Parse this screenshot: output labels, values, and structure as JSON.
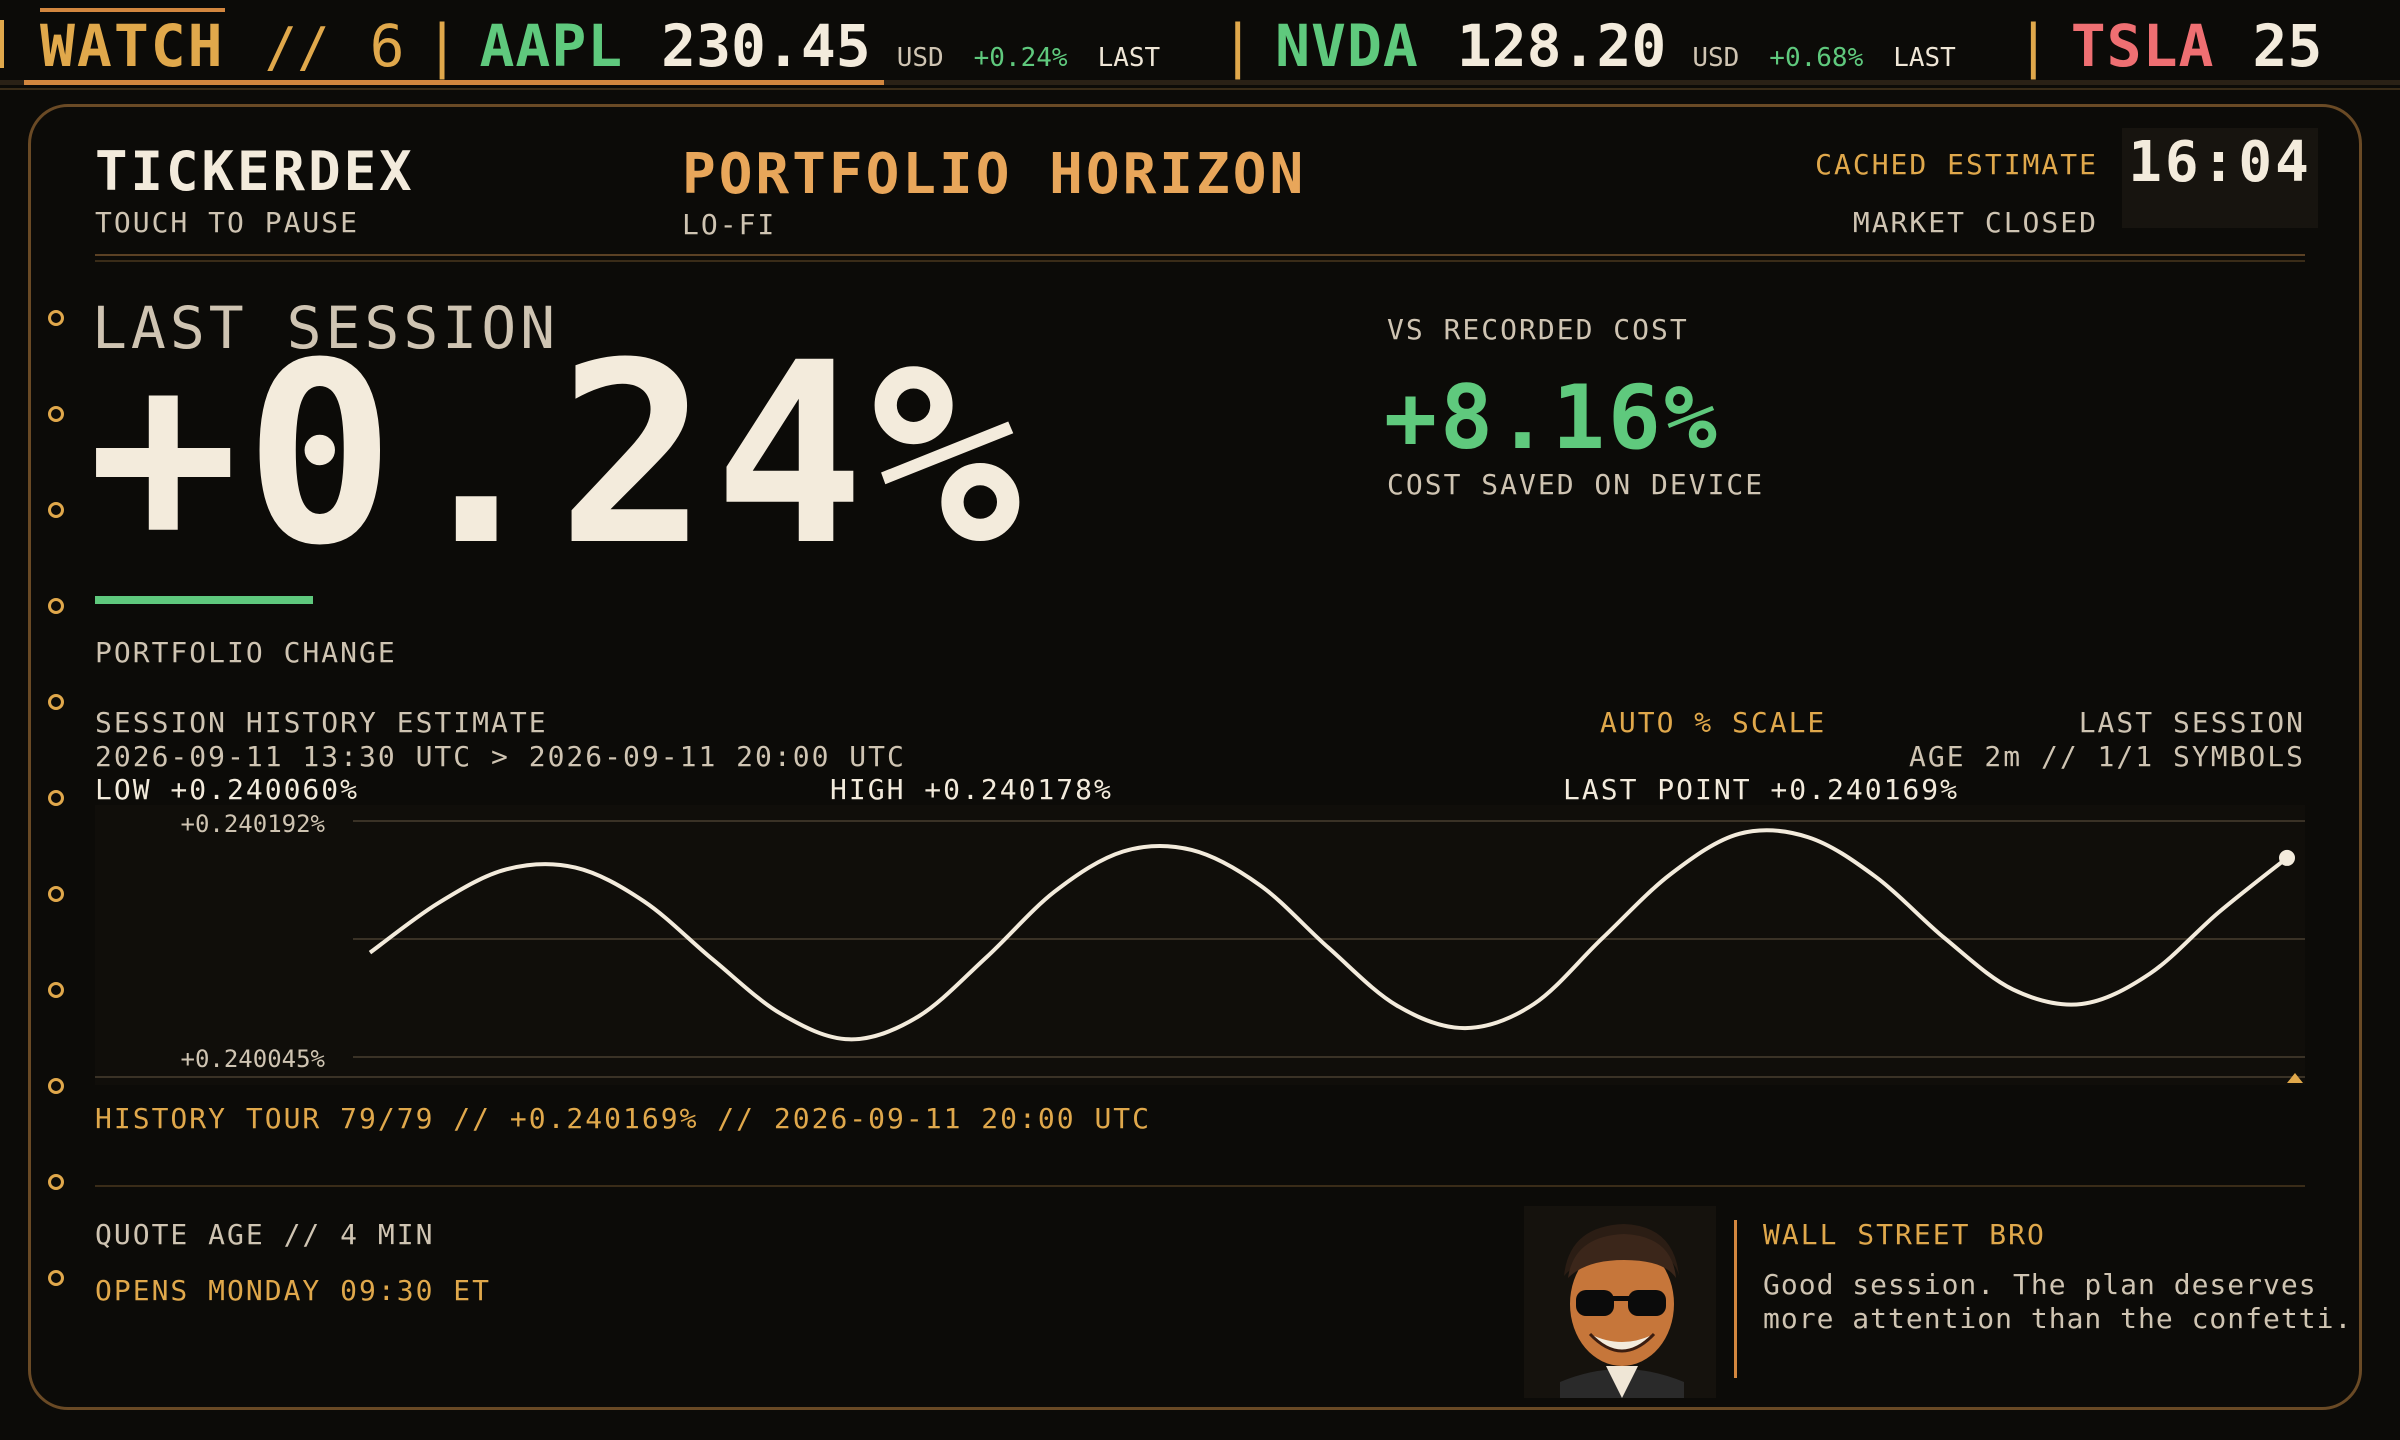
{
  "ticker": {
    "watch_label": "WATCH",
    "separator": "//",
    "watch_count": "6",
    "items": [
      {
        "symbol": "AAPL",
        "price": "230.45",
        "currency": "USD",
        "change": "+0.24%",
        "status": "LAST"
      },
      {
        "symbol": "NVDA",
        "price": "128.20",
        "currency": "USD",
        "change": "+0.68%",
        "status": "LAST"
      },
      {
        "symbol": "TSLA",
        "price": "25"
      }
    ]
  },
  "header": {
    "brand": "TICKERDEX",
    "brand_hint": "TOUCH TO PAUSE",
    "title": "PORTFOLIO HORIZON",
    "subtitle": "LO-FI",
    "cache_label": "CACHED ESTIMATE",
    "market_status": "MARKET CLOSED",
    "clock": "16:04"
  },
  "hero": {
    "label": "LAST SESSION",
    "value": "+0.24%",
    "caption": "PORTFOLIO CHANGE"
  },
  "cost": {
    "label": "VS RECORDED COST",
    "value": "+8.16%",
    "caption": "COST SAVED ON DEVICE"
  },
  "history": {
    "title": "SESSION HISTORY ESTIMATE",
    "range": "2026-09-11 13:30 UTC > 2026-09-11 20:00 UTC",
    "scale_mode": "AUTO % SCALE",
    "session": "LAST SESSION",
    "age": "AGE 2m // 1/1 SYMBOLS",
    "low": "LOW +0.240060%",
    "high": "HIGH +0.240178%",
    "last_point": "LAST POINT +0.240169%",
    "tour": "HISTORY TOUR 79/79 // +0.240169% // 2026-09-11 20:00 UTC"
  },
  "chart_data": {
    "type": "line",
    "ytick_labels": [
      "+0.240192%",
      "+0.240045%"
    ],
    "ylim": [
      0.240045,
      0.240192
    ],
    "x_start": "2026-09-11 13:30 UTC",
    "x_end": "2026-09-11 20:00 UTC",
    "points": 79,
    "y": [
      0.24011,
      0.240141,
      0.240162,
      0.240163,
      0.240142,
      0.240106,
      0.240072,
      0.240056,
      0.24007,
      0.240107,
      0.240148,
      0.240173,
      0.240174,
      0.240152,
      0.240113,
      0.240077,
      0.240063,
      0.240078,
      0.240119,
      0.240159,
      0.240184,
      0.240182,
      0.240157,
      0.240119,
      0.240087,
      0.240078,
      0.240097,
      0.240135,
      0.240169
    ],
    "line_color": "#f3ebdc",
    "grid": true
  },
  "footer": {
    "quote_age": "QUOTE AGE // 4 MIN",
    "opens": "OPENS MONDAY 09:30 ET"
  },
  "bro": {
    "name": "WALL STREET BRO",
    "message": "Good session. The plan deserves more attention than the confetti."
  },
  "colors": {
    "accent": "#e0a84b",
    "positive": "#5fc97d",
    "negative": "#ef6f72",
    "text": "#f3ebdc",
    "frame": "#6a4a25"
  }
}
